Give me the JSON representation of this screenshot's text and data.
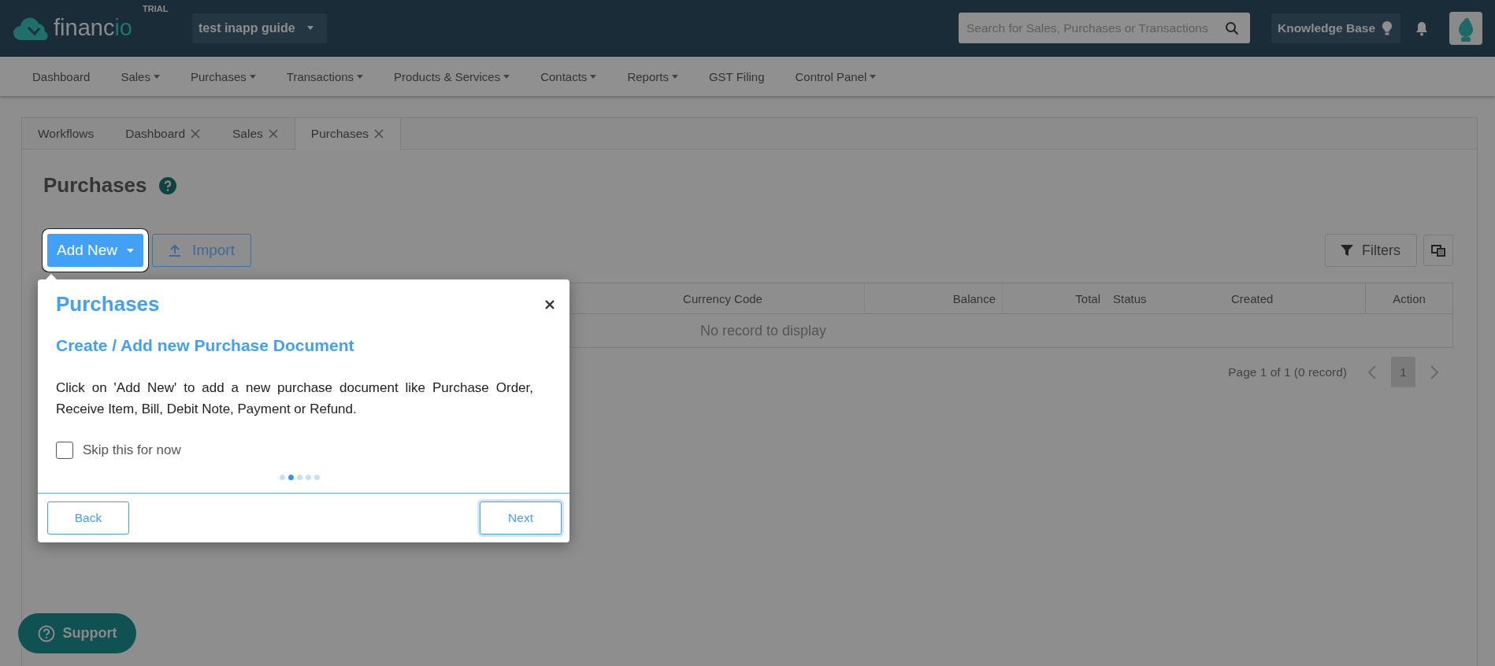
{
  "header": {
    "logo": {
      "parts": [
        {
          "text": "financ",
          "accent": false
        },
        {
          "text": "io",
          "accent": true
        }
      ]
    },
    "badge": "TRIAL",
    "org_selector": "test inapp guide",
    "search": {
      "placeholder": "Search for Sales, Purchases or Transactions"
    },
    "knowledge_base": "Knowledge Base"
  },
  "nav": [
    {
      "label": "Dashboard",
      "dropdown": false
    },
    {
      "label": "Sales",
      "dropdown": true
    },
    {
      "label": "Purchases",
      "dropdown": true
    },
    {
      "label": "Transactions",
      "dropdown": true
    },
    {
      "label": "Products & Services",
      "dropdown": true
    },
    {
      "label": "Contacts",
      "dropdown": true
    },
    {
      "label": "Reports",
      "dropdown": true
    },
    {
      "label": "GST Filing",
      "dropdown": false
    },
    {
      "label": "Control Panel",
      "dropdown": true
    }
  ],
  "tabs": [
    {
      "label": "Workflows",
      "closable": false,
      "selected": false
    },
    {
      "label": "Dashboard",
      "closable": true,
      "selected": false
    },
    {
      "label": "Sales",
      "closable": true,
      "selected": false
    },
    {
      "label": "Purchases",
      "closable": true,
      "selected": true
    }
  ],
  "page": {
    "title": "Purchases",
    "add_new": "Add New",
    "import": "Import",
    "filters": "Filters"
  },
  "table": {
    "columns": [
      {
        "label": "Currency Code"
      },
      {
        "label": "Balance"
      },
      {
        "label": "Total"
      },
      {
        "label": "Status"
      },
      {
        "label": "Created"
      },
      {
        "label": "Action"
      }
    ],
    "empty_text": "No record to display"
  },
  "pagination": {
    "summary": "Page 1 of 1 (0 record)",
    "pages": [
      {
        "label": "1",
        "selected": true
      }
    ]
  },
  "guide": {
    "title": "Purchases",
    "subtitle": "Create / Add new Purchase Document",
    "body": "Click on 'Add New' to add a new purchase document like Purchase Order, Receive Item, Bill, Debit Note, Payment or Refund.",
    "skip": {
      "label": "Skip this for now",
      "checked": false
    },
    "steps": [
      {
        "selected": false
      },
      {
        "selected": true
      },
      {
        "selected": false
      },
      {
        "selected": false
      },
      {
        "selected": false
      }
    ],
    "buttons": [
      {
        "label": "Back",
        "focused": false
      },
      {
        "label": "Next",
        "focused": true
      }
    ]
  },
  "support": "Support"
}
